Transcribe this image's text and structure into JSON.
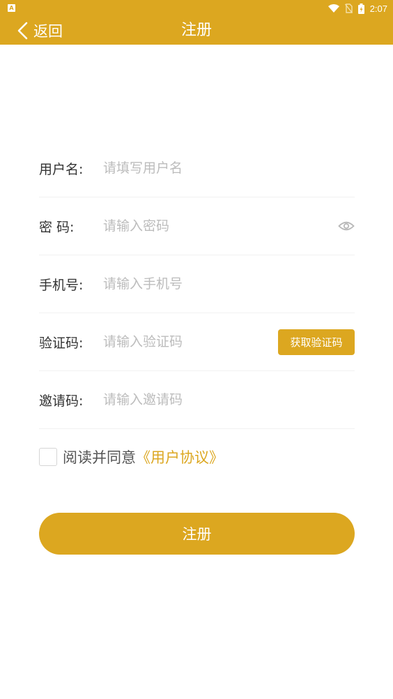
{
  "status_bar": {
    "left_icon_letter": "A",
    "time": "2:07",
    "icons": [
      "wifi-icon",
      "no-sim-icon",
      "battery-charging-icon"
    ]
  },
  "header": {
    "back_label": "返回",
    "title": "注册",
    "back_icon": "chevron-left-icon"
  },
  "form": {
    "username": {
      "label": "用户名:",
      "placeholder": "请填写用户名",
      "value": ""
    },
    "password": {
      "label": "密 码:",
      "placeholder": "请输入密码",
      "value": "",
      "toggle_icon": "eye-icon"
    },
    "phone": {
      "label": "手机号:",
      "placeholder": "请输入手机号",
      "value": ""
    },
    "code": {
      "label": "验证码:",
      "placeholder": "请输入验证码",
      "value": "",
      "button_label": "获取验证码"
    },
    "invite": {
      "label": "邀请码:",
      "placeholder": "请输入邀请码",
      "value": ""
    }
  },
  "agreement": {
    "checked": false,
    "text": "阅读并同意",
    "link_text": "《用户协议》"
  },
  "submit": {
    "label": "注册"
  },
  "colors": {
    "accent": "#dca720",
    "placeholder": "#bcbcbc",
    "label": "#333333",
    "divider": "#f1f1f1"
  }
}
